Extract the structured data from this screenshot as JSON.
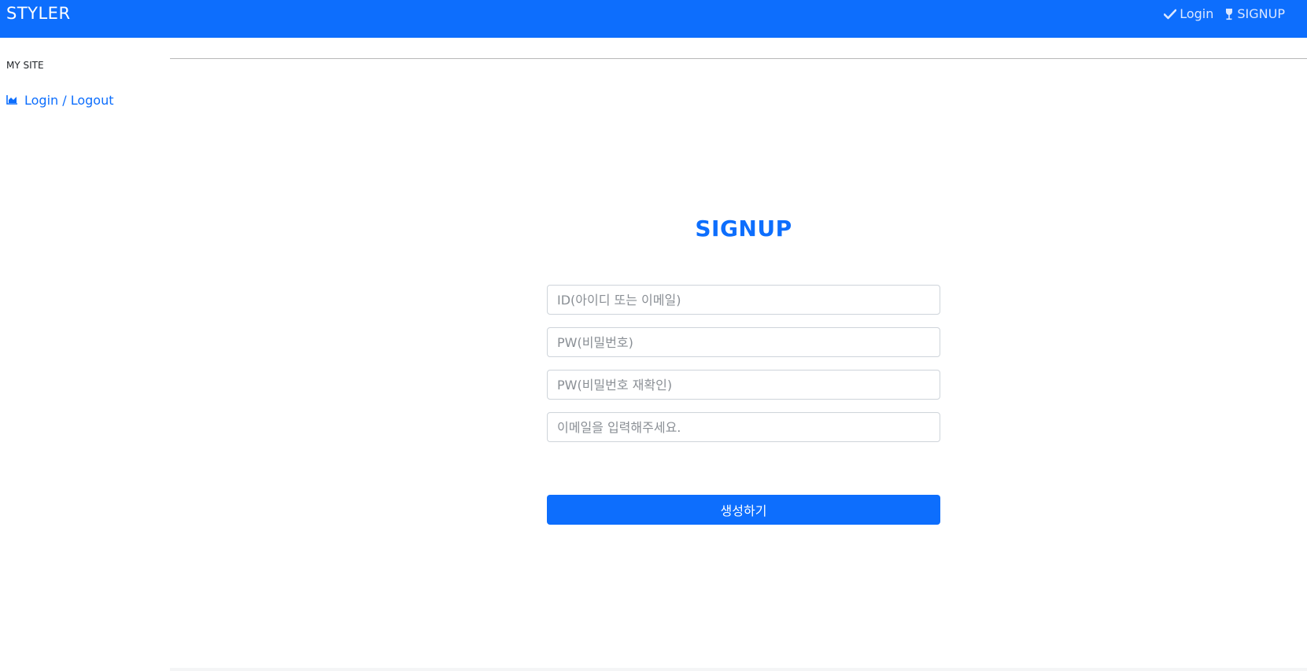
{
  "navbar": {
    "brand": "STYLER",
    "links": [
      {
        "label": "Login",
        "icon": "check-icon"
      },
      {
        "label": "SIGNUP",
        "icon": "wine-glass-icon"
      }
    ]
  },
  "sidebar": {
    "heading": "MY SITE",
    "items": [
      {
        "label": "Login / Logout",
        "icon": "area-chart-icon"
      }
    ]
  },
  "form": {
    "title": "SIGNUP",
    "id_placeholder": "ID(아이디 또는 이메일)",
    "pw_placeholder": "PW(비밀번호)",
    "pw_confirm_placeholder": "PW(비밀번호 재확인)",
    "email_placeholder": "이메일을 입력해주세요.",
    "submit_label": "생성하기"
  },
  "colors": {
    "primary": "#0d6efd",
    "navbar_text": "#ffffff",
    "border": "#ced4da"
  }
}
